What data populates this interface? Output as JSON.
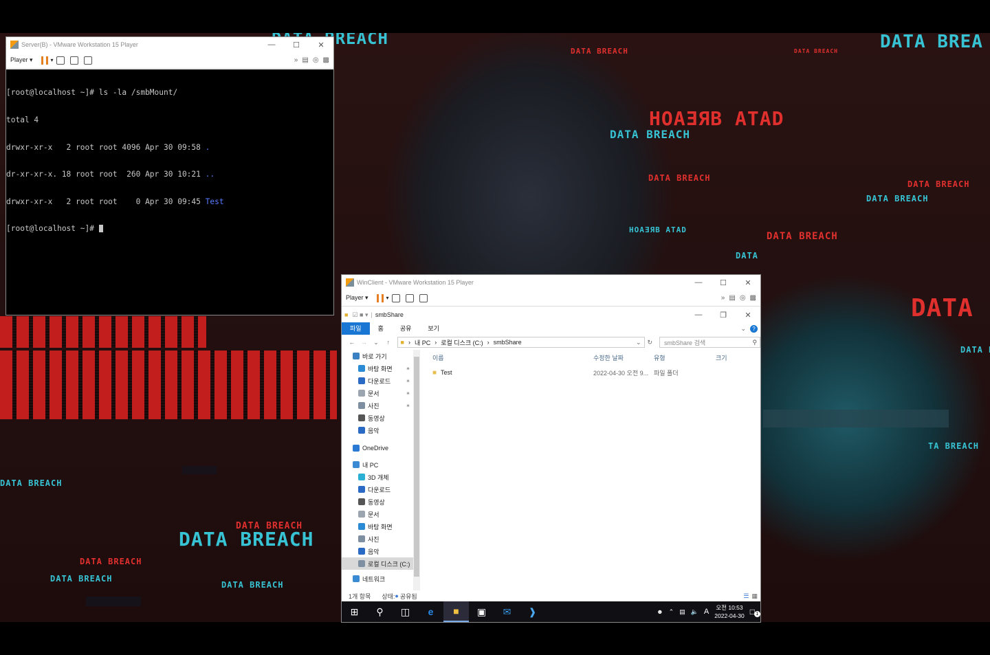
{
  "wallpaper": {
    "texts": [
      "DATA BREACH",
      "DATA BREA",
      "DATA BREACH",
      "DATA BREACH",
      "HOAƎЯB ATAD",
      "DATA BREACH",
      "DATA BREACH",
      "DATA BREACH",
      "DATA BREACH",
      "HOAƎЯB ATAD",
      "DATA BREACH",
      "DATA",
      "DATA B",
      "DATA BREACH",
      "TA BREACH",
      "DATA BREACH",
      "DATA BREACH",
      "DATA BREACH",
      "DATA BREACH",
      "DATA BREACH",
      "DATA BREACH"
    ]
  },
  "server_window": {
    "title": "Server(B) - VMware Workstation 15 Player",
    "player_label": "Player",
    "terminal_lines": [
      {
        "text": "[root@localhost ~]# ls -la /smbMount/",
        "highlight": ""
      },
      {
        "text": "total 4",
        "highlight": ""
      },
      {
        "text": "drwxr-xr-x   2 root root 4096 Apr 30 09:58 ",
        "highlight": "."
      },
      {
        "text": "dr-xr-xr-x. 18 root root  260 Apr 30 10:21 ",
        "highlight": ".."
      },
      {
        "text": "drwxr-xr-x   2 root root    0 Apr 30 09:45 ",
        "highlight": "Test"
      },
      {
        "text": "[root@localhost ~]# ",
        "highlight": ""
      }
    ]
  },
  "client_window": {
    "title": "WinClient - VMware Workstation 15 Player",
    "player_label": "Player",
    "explorer": {
      "title": "smbShare",
      "tabs": [
        "파일",
        "홈",
        "공유",
        "보기"
      ],
      "breadcrumb": [
        "내 PC",
        "로컬 디스크 (C:)",
        "smbShare"
      ],
      "search_placeholder": "smbShare 검색",
      "nav": [
        {
          "label": "바로 가기",
          "icon": "star-icon",
          "indent": 0,
          "pin": false,
          "color": "#3b82c4"
        },
        {
          "label": "바탕 화면",
          "icon": "desktop-icon",
          "indent": 1,
          "pin": true,
          "color": "#2a8ad4"
        },
        {
          "label": "다운로드",
          "icon": "download-icon",
          "indent": 1,
          "pin": true,
          "color": "#2a6ac4"
        },
        {
          "label": "문서",
          "icon": "document-icon",
          "indent": 1,
          "pin": true,
          "color": "#9aa5b0"
        },
        {
          "label": "사진",
          "icon": "pictures-icon",
          "indent": 1,
          "pin": true,
          "color": "#7d8fa0"
        },
        {
          "label": "동영상",
          "icon": "videos-icon",
          "indent": 1,
          "pin": false,
          "color": "#555"
        },
        {
          "label": "음악",
          "icon": "music-icon",
          "indent": 1,
          "pin": false,
          "color": "#2a6ac4"
        },
        {
          "label": "OneDrive",
          "icon": "cloud-icon",
          "indent": 0,
          "pin": false,
          "color": "#2a7ad4"
        },
        {
          "label": "내 PC",
          "icon": "pc-icon",
          "indent": 0,
          "pin": false,
          "color": "#3a8ad4"
        },
        {
          "label": "3D 개체",
          "icon": "3d-objects-icon",
          "indent": 1,
          "pin": false,
          "color": "#2ab0d4"
        },
        {
          "label": "다운로드",
          "icon": "download-icon",
          "indent": 1,
          "pin": false,
          "color": "#2a6ac4"
        },
        {
          "label": "동영상",
          "icon": "videos-icon",
          "indent": 1,
          "pin": false,
          "color": "#555"
        },
        {
          "label": "문서",
          "icon": "document-icon",
          "indent": 1,
          "pin": false,
          "color": "#9aa5b0"
        },
        {
          "label": "바탕 화면",
          "icon": "desktop-icon",
          "indent": 1,
          "pin": false,
          "color": "#2a8ad4"
        },
        {
          "label": "사진",
          "icon": "pictures-icon",
          "indent": 1,
          "pin": false,
          "color": "#7d8fa0"
        },
        {
          "label": "음악",
          "icon": "music-icon",
          "indent": 1,
          "pin": false,
          "color": "#2a6ac4"
        },
        {
          "label": "로컬 디스크 (C:)",
          "icon": "drive-icon",
          "indent": 1,
          "pin": false,
          "color": "#7d8fa0",
          "selected": true
        },
        {
          "label": "네트워크",
          "icon": "network-icon",
          "indent": 0,
          "pin": false,
          "color": "#3a8ad4"
        }
      ],
      "columns": [
        "이름",
        "수정한 날짜",
        "유형",
        "크기"
      ],
      "files": [
        {
          "name": "Test",
          "modified": "2022-04-30 오전 9...",
          "type": "파일 폴더",
          "size": ""
        }
      ],
      "status_count": "1개 항목",
      "status_state": "상태: ",
      "status_shared": "공유됨"
    },
    "taskbar": {
      "clock_time": "오전 10:53",
      "clock_date": "2022-04-30",
      "ime": "A",
      "notification_count": "1"
    }
  }
}
